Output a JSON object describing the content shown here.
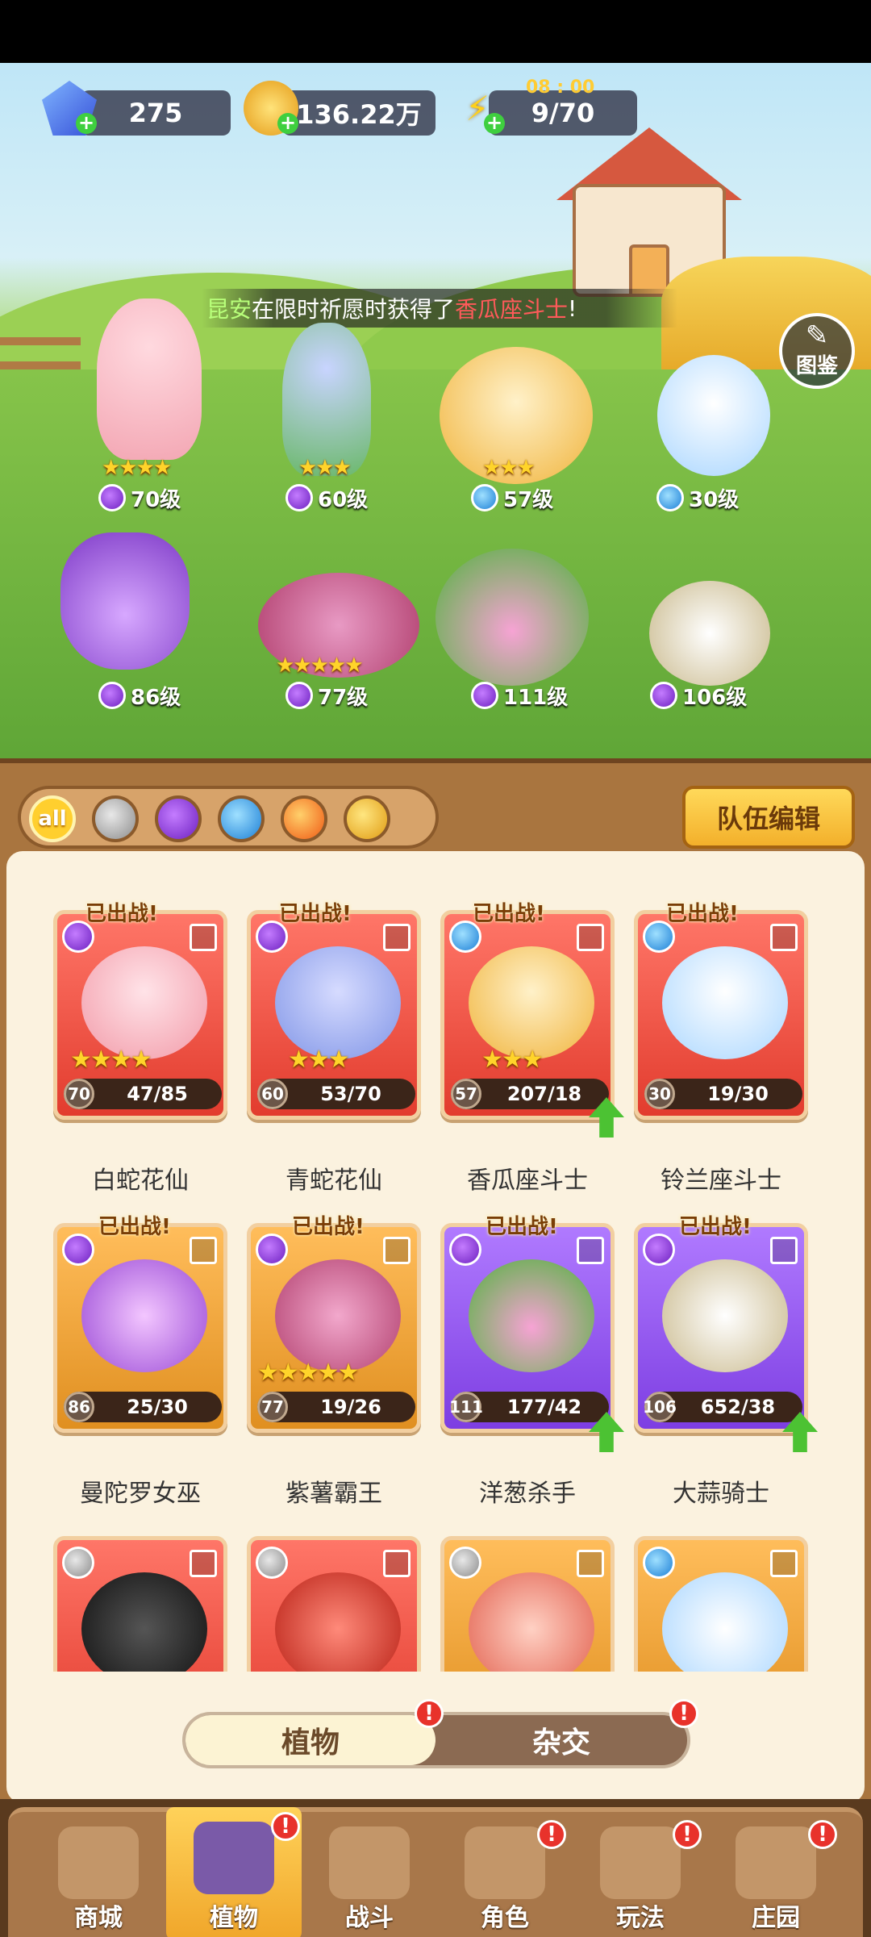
{
  "resources": {
    "gems": "275",
    "coins": "136.22万",
    "energy": "9/70",
    "energy_timer": "08 : 00"
  },
  "ticker": {
    "player": "昆安",
    "middle": "在限时祈愿时获得了",
    "reward": "香瓜座斗士",
    "end": "!"
  },
  "dex_label": "图鉴",
  "lineup": [
    {
      "level": "70级",
      "element": "poison",
      "stars": "★★★★"
    },
    {
      "level": "60级",
      "element": "poison",
      "stars": "★★★"
    },
    {
      "level": "57级",
      "element": "water",
      "stars": "★★★"
    },
    {
      "level": "30级",
      "element": "water",
      "stars": ""
    },
    {
      "level": "86级",
      "element": "poison",
      "stars": ""
    },
    {
      "level": "77级",
      "element": "poison",
      "stars": "★★★★★"
    },
    {
      "level": "111级",
      "element": "poison",
      "stars": ""
    },
    {
      "level": "106级",
      "element": "poison",
      "stars": ""
    }
  ],
  "filters": [
    "all",
    "sword",
    "poison",
    "water",
    "fire",
    "bolt"
  ],
  "team_edit": "队伍编辑",
  "deployed_label": "已出战!",
  "cards": [
    {
      "name": "白蛇花仙",
      "level": "70",
      "progress": "47/85",
      "stars": "★★★★",
      "color": "red",
      "element": "poison",
      "deployed": true,
      "upgrade": false
    },
    {
      "name": "青蛇花仙",
      "level": "60",
      "progress": "53/70",
      "stars": "★★★",
      "color": "red",
      "element": "poison",
      "deployed": true,
      "upgrade": false
    },
    {
      "name": "香瓜座斗士",
      "level": "57",
      "progress": "207/18",
      "stars": "★★★",
      "color": "red",
      "element": "water",
      "deployed": true,
      "upgrade": true
    },
    {
      "name": "铃兰座斗士",
      "level": "30",
      "progress": "19/30",
      "stars": "",
      "color": "red",
      "element": "water",
      "deployed": true,
      "upgrade": false
    },
    {
      "name": "曼陀罗女巫",
      "level": "86",
      "progress": "25/30",
      "stars": "",
      "color": "orange",
      "element": "poison",
      "deployed": true,
      "upgrade": false
    },
    {
      "name": "紫薯霸王",
      "level": "77",
      "progress": "19/26",
      "stars": "★★★★★",
      "color": "orange",
      "element": "poison",
      "deployed": true,
      "upgrade": false
    },
    {
      "name": "洋葱杀手",
      "level": "111",
      "progress": "177/42",
      "stars": "",
      "color": "purple",
      "element": "poison",
      "deployed": true,
      "upgrade": true
    },
    {
      "name": "大蒜骑士",
      "level": "106",
      "progress": "652/38",
      "stars": "",
      "color": "purple",
      "element": "poison",
      "deployed": true,
      "upgrade": true
    },
    {
      "name": "",
      "level": "",
      "progress": "",
      "stars": "",
      "color": "red",
      "element": "sword",
      "deployed": false,
      "upgrade": false
    },
    {
      "name": "",
      "level": "",
      "progress": "",
      "stars": "",
      "color": "red",
      "element": "sword",
      "deployed": false,
      "upgrade": false
    },
    {
      "name": "",
      "level": "",
      "progress": "",
      "stars": "",
      "color": "orange",
      "element": "sword",
      "deployed": false,
      "upgrade": false
    },
    {
      "name": "",
      "level": "",
      "progress": "",
      "stars": "",
      "color": "orange",
      "element": "water",
      "deployed": false,
      "upgrade": false
    }
  ],
  "toggle": {
    "active": "植物",
    "inactive": "杂交"
  },
  "nav": [
    {
      "label": "商城",
      "badge": ""
    },
    {
      "label": "植物",
      "badge": "!"
    },
    {
      "label": "战斗",
      "badge": ""
    },
    {
      "label": "角色",
      "badge": "!"
    },
    {
      "label": "玩法",
      "badge": "!"
    },
    {
      "label": "庄园",
      "badge": "!"
    }
  ],
  "icons": {
    "gem": "gem-icon",
    "coin": "coin-icon",
    "energy": "lightning-icon",
    "dex": "book-icon",
    "shop": "shop-icon",
    "plant": "plant-icon",
    "battle": "windmill-icon",
    "role": "character-icon",
    "play": "gameplay-icon",
    "manor": "manor-icon"
  }
}
